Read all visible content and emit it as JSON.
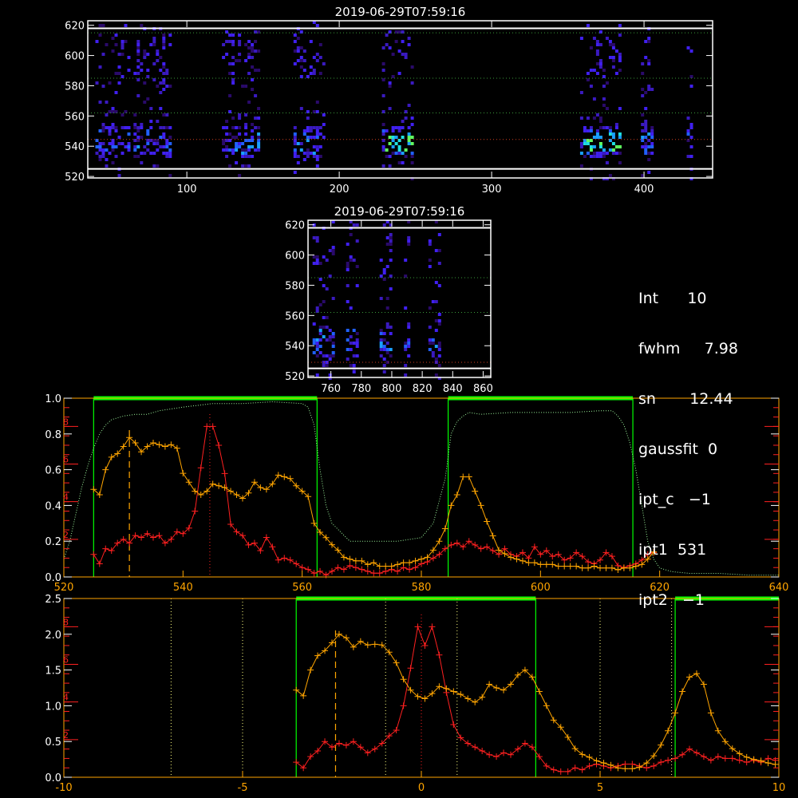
{
  "colors": {
    "white": "#ffffff",
    "orange": "#ffa500",
    "red": "#ff2020",
    "green": "#00ff00",
    "dotted_green": "#9cf59c",
    "grid_green": "#3a9a3a",
    "grid_red": "#d04020",
    "yellow_dotted": "#ffff80"
  },
  "info": [
    {
      "key": "Int",
      "value": "10"
    },
    {
      "key": "fwhm",
      "value": "7.98"
    },
    {
      "key": "sn",
      "value": "12.44"
    },
    {
      "key": "gaussfit",
      "value": "0"
    },
    {
      "key": "ipt_c",
      "value": "−1"
    },
    {
      "key": "ipt1",
      "value": "531"
    },
    {
      "key": "ipt2",
      "value": "−1"
    }
  ],
  "info_lines": [
    "Int      10",
    "fwhm     7.98",
    "sn       12.44",
    "gaussfit  0",
    "ipt_c   −1",
    "ipt1  531",
    "ipt2   −1"
  ],
  "chart_data": [
    {
      "type": "heatmap",
      "id": "top",
      "title": "2019-06-29T07:59:16",
      "xlim": [
        35,
        445
      ],
      "ylim": [
        519,
        623
      ],
      "xticks": [
        100,
        200,
        300,
        400
      ],
      "yticks": [
        520,
        540,
        560,
        580,
        600,
        620
      ],
      "hlines": [
        {
          "y": 525,
          "style": "solid"
        },
        {
          "y": 544.5,
          "style": "red-dotted"
        },
        {
          "y": 562,
          "style": "green-dotted"
        },
        {
          "y": 585,
          "style": "green-dotted"
        },
        {
          "y": 615,
          "style": "green-dotted"
        },
        {
          "y": 618,
          "style": "solid"
        }
      ],
      "bands": [
        [
          40,
          63
        ],
        [
          65,
          90
        ],
        [
          123,
          148
        ],
        [
          170,
          190
        ],
        [
          228,
          248
        ],
        [
          358,
          385
        ],
        [
          398,
          405
        ],
        [
          428,
          431
        ]
      ],
      "hot_bands": [
        [
          228,
          248
        ],
        [
          360,
          385
        ]
      ],
      "hot_rows": [
        538,
        550
      ]
    },
    {
      "type": "heatmap",
      "id": "mid",
      "title": "2019-06-29T07:59:16",
      "xlim": [
        745,
        865
      ],
      "ylim": [
        519,
        623
      ],
      "xticks": [
        760,
        780,
        800,
        820,
        840,
        860
      ],
      "yticks": [
        520,
        540,
        560,
        580,
        600,
        620
      ],
      "hlines": [
        {
          "y": 525,
          "style": "solid"
        },
        {
          "y": 529,
          "style": "red-dotted"
        },
        {
          "y": 562,
          "style": "green-dotted"
        },
        {
          "y": 585,
          "style": "green-dotted"
        },
        {
          "y": 618,
          "style": "solid"
        }
      ],
      "columns": [
        [
          748,
          762
        ],
        [
          770,
          778
        ],
        [
          792,
          800
        ],
        [
          808,
          812
        ],
        [
          824,
          832
        ]
      ]
    },
    {
      "type": "line",
      "id": "spectrum",
      "xlim": [
        520,
        640
      ],
      "xticks": [
        520,
        540,
        560,
        580,
        600,
        620,
        640
      ],
      "left_axis_ticks": [
        "0.0",
        "0.2",
        "0.4",
        "0.6",
        "0.8",
        "1.0"
      ],
      "right_axis_ticks": [
        "2",
        "4",
        "6",
        "8"
      ],
      "left_axis_max": 1.0,
      "right_axis_max": 9.5,
      "green_regions": [
        [
          525,
          562.5
        ],
        [
          584.5,
          615.5
        ]
      ],
      "orange_vline": 531,
      "red_vline": 544.5,
      "orange_x": [
        525,
        526,
        527,
        528,
        529,
        530,
        531,
        532,
        533,
        534,
        535,
        536,
        537,
        538,
        539,
        540,
        541,
        542,
        543,
        544,
        545,
        546,
        547,
        548,
        549,
        550,
        551,
        552,
        553,
        554,
        555,
        556,
        557,
        558,
        559,
        560,
        561,
        562,
        563,
        564,
        565,
        566,
        567,
        568,
        569,
        570,
        571,
        572,
        573,
        574,
        575,
        576,
        577,
        578,
        579,
        580,
        581,
        582,
        583,
        584,
        585,
        586,
        587,
        588,
        589,
        590,
        591,
        592,
        593,
        594,
        595,
        596,
        597,
        598,
        599,
        600,
        601,
        602,
        603,
        604,
        605,
        606,
        607,
        608,
        609,
        610,
        611,
        612,
        613,
        614,
        615,
        616,
        617,
        618,
        619
      ],
      "orange": [
        0.49,
        0.46,
        0.6,
        0.67,
        0.69,
        0.73,
        0.78,
        0.75,
        0.7,
        0.73,
        0.75,
        0.74,
        0.73,
        0.74,
        0.72,
        0.58,
        0.53,
        0.48,
        0.46,
        0.48,
        0.52,
        0.51,
        0.5,
        0.48,
        0.46,
        0.44,
        0.47,
        0.53,
        0.5,
        0.49,
        0.52,
        0.57,
        0.56,
        0.55,
        0.51,
        0.48,
        0.45,
        0.3,
        0.25,
        0.22,
        0.18,
        0.15,
        0.11,
        0.1,
        0.09,
        0.09,
        0.07,
        0.08,
        0.06,
        0.06,
        0.06,
        0.07,
        0.08,
        0.08,
        0.09,
        0.1,
        0.11,
        0.15,
        0.2,
        0.27,
        0.4,
        0.46,
        0.56,
        0.56,
        0.48,
        0.4,
        0.31,
        0.23,
        0.15,
        0.13,
        0.11,
        0.1,
        0.09,
        0.08,
        0.08,
        0.07,
        0.07,
        0.07,
        0.06,
        0.06,
        0.06,
        0.06,
        0.05,
        0.05,
        0.06,
        0.05,
        0.05,
        0.05,
        0.04,
        0.05,
        0.05,
        0.06,
        0.07,
        0.1,
        0.14
      ],
      "red_x": [
        525,
        526,
        527,
        528,
        529,
        530,
        531,
        532,
        533,
        534,
        535,
        536,
        537,
        538,
        539,
        540,
        541,
        542,
        543,
        544,
        545,
        546,
        547,
        548,
        549,
        550,
        551,
        552,
        553,
        554,
        555,
        556,
        557,
        558,
        559,
        560,
        561,
        562,
        563,
        564,
        565,
        566,
        567,
        568,
        569,
        570,
        571,
        572,
        573,
        574,
        575,
        576,
        577,
        578,
        579,
        580,
        581,
        582,
        583,
        584,
        585,
        586,
        587,
        588,
        589,
        590,
        591,
        592,
        593,
        594,
        595,
        596,
        597,
        598,
        599,
        600,
        601,
        602,
        603,
        604,
        605,
        606,
        607,
        608,
        609,
        610,
        611,
        612,
        613,
        614,
        615,
        616,
        617,
        618,
        619
      ],
      "red": [
        1.2,
        0.7,
        1.5,
        1.4,
        1.8,
        2.0,
        1.8,
        2.2,
        2.1,
        2.3,
        2.1,
        2.2,
        1.8,
        2.0,
        2.4,
        2.3,
        2.6,
        3.5,
        5.8,
        8.0,
        8.0,
        7.0,
        5.5,
        2.8,
        2.4,
        2.2,
        1.7,
        1.8,
        1.4,
        2.1,
        1.6,
        0.9,
        1.0,
        0.9,
        0.7,
        0.5,
        0.4,
        0.2,
        0.3,
        0.1,
        0.3,
        0.5,
        0.4,
        0.6,
        0.5,
        0.4,
        0.3,
        0.2,
        0.2,
        0.3,
        0.4,
        0.3,
        0.5,
        0.4,
        0.5,
        0.7,
        0.8,
        1.0,
        1.2,
        1.5,
        1.7,
        1.8,
        1.6,
        1.9,
        1.7,
        1.5,
        1.6,
        1.4,
        1.2,
        1.5,
        1.2,
        1.1,
        1.3,
        1.0,
        1.6,
        1.2,
        1.4,
        1.1,
        1.2,
        0.9,
        1.0,
        1.3,
        1.1,
        0.8,
        0.7,
        0.9,
        1.3,
        1.1,
        0.6,
        0.5,
        0.6,
        0.7,
        0.9,
        1.2,
        1.3
      ],
      "dotted_x": [
        520,
        521,
        522,
        523,
        524,
        525,
        526,
        527,
        528,
        530,
        532,
        534,
        536,
        540,
        545,
        550,
        555,
        560,
        561,
        562,
        563,
        564,
        565,
        568,
        572,
        576,
        580,
        582,
        584,
        585,
        586,
        587,
        588,
        590,
        595,
        600,
        605,
        610,
        612,
        613,
        614,
        615,
        616,
        617,
        618,
        619,
        620,
        622,
        625,
        630,
        635,
        640
      ],
      "dotted": [
        0.1,
        0.2,
        0.35,
        0.5,
        0.62,
        0.72,
        0.8,
        0.85,
        0.88,
        0.9,
        0.91,
        0.91,
        0.93,
        0.95,
        0.97,
        0.97,
        0.98,
        0.97,
        0.95,
        0.85,
        0.6,
        0.4,
        0.3,
        0.2,
        0.2,
        0.2,
        0.22,
        0.3,
        0.55,
        0.8,
        0.87,
        0.9,
        0.92,
        0.91,
        0.92,
        0.92,
        0.92,
        0.93,
        0.93,
        0.9,
        0.85,
        0.75,
        0.6,
        0.4,
        0.2,
        0.1,
        0.05,
        0.03,
        0.02,
        0.02,
        0.01,
        0.01
      ]
    },
    {
      "type": "line",
      "id": "velocity",
      "xlim": [
        -10,
        10
      ],
      "xticks": [
        -10,
        -5,
        0,
        5,
        10
      ],
      "left_axis_ticks": [
        "0.0",
        "0.5",
        "1.0",
        "1.5",
        "2.0",
        "2.5"
      ],
      "right_axis_ticks": [
        "2",
        "4",
        "6",
        "8"
      ],
      "left_axis_max": 2.5,
      "right_axis_max": 9.5,
      "green_regions": [
        [
          -3.5,
          3.2
        ],
        [
          7.1,
          10
        ]
      ],
      "orange_vline": -2.4,
      "red_vline": 0,
      "white_dotted_vlines": [
        -7,
        -5,
        -1,
        1,
        5,
        7
      ],
      "orange_x": [
        -3.5,
        -3.3,
        -3.1,
        -2.9,
        -2.7,
        -2.5,
        -2.3,
        -2.1,
        -1.9,
        -1.7,
        -1.5,
        -1.3,
        -1.1,
        -0.9,
        -0.7,
        -0.5,
        -0.3,
        -0.1,
        0.1,
        0.3,
        0.5,
        0.7,
        0.9,
        1.1,
        1.3,
        1.5,
        1.7,
        1.9,
        2.1,
        2.3,
        2.5,
        2.7,
        2.9,
        3.1,
        3.3,
        3.5,
        3.7,
        3.9,
        4.1,
        4.3,
        4.5,
        4.7,
        4.9,
        5.1,
        5.3,
        5.5,
        5.7,
        5.9,
        6.1,
        6.3,
        6.5,
        6.7,
        6.9,
        7.1,
        7.3,
        7.5,
        7.7,
        7.9,
        8.1,
        8.3,
        8.5,
        8.7,
        8.9,
        9.1,
        9.3,
        9.5,
        9.7,
        9.9
      ],
      "orange": [
        1.22,
        1.14,
        1.5,
        1.7,
        1.77,
        1.88,
        2.0,
        1.95,
        1.82,
        1.9,
        1.85,
        1.86,
        1.85,
        1.75,
        1.6,
        1.37,
        1.22,
        1.13,
        1.1,
        1.17,
        1.27,
        1.24,
        1.2,
        1.16,
        1.1,
        1.05,
        1.12,
        1.3,
        1.25,
        1.22,
        1.3,
        1.43,
        1.5,
        1.4,
        1.2,
        1.0,
        0.8,
        0.7,
        0.56,
        0.4,
        0.32,
        0.28,
        0.23,
        0.2,
        0.17,
        0.13,
        0.12,
        0.12,
        0.14,
        0.2,
        0.3,
        0.45,
        0.65,
        0.9,
        1.2,
        1.4,
        1.45,
        1.3,
        0.9,
        0.65,
        0.5,
        0.4,
        0.33,
        0.28,
        0.25,
        0.23,
        0.2,
        0.18
      ],
      "red_x": [
        -3.5,
        -3.3,
        -3.1,
        -2.9,
        -2.7,
        -2.5,
        -2.3,
        -2.1,
        -1.9,
        -1.7,
        -1.5,
        -1.3,
        -1.1,
        -0.9,
        -0.7,
        -0.5,
        -0.3,
        -0.1,
        0.1,
        0.3,
        0.5,
        0.7,
        0.9,
        1.1,
        1.3,
        1.5,
        1.7,
        1.9,
        2.1,
        2.3,
        2.5,
        2.7,
        2.9,
        3.1,
        3.3,
        3.5,
        3.7,
        3.9,
        4.1,
        4.3,
        4.5,
        4.7,
        4.9,
        5.1,
        5.3,
        5.5,
        5.7,
        5.9,
        6.1,
        6.3,
        6.5,
        6.7,
        6.9,
        7.1,
        7.3,
        7.5,
        7.7,
        7.9,
        8.1,
        8.3,
        8.5,
        8.7,
        8.9,
        9.1,
        9.3,
        9.5,
        9.7,
        9.9
      ],
      "red": [
        0.8,
        0.5,
        1.1,
        1.4,
        1.9,
        1.6,
        1.8,
        1.7,
        1.9,
        1.6,
        1.3,
        1.5,
        1.8,
        2.2,
        2.5,
        3.8,
        5.8,
        8.0,
        7.0,
        8.0,
        6.5,
        4.5,
        2.8,
        2.1,
        1.8,
        1.6,
        1.4,
        1.2,
        1.1,
        1.3,
        1.2,
        1.5,
        1.8,
        1.6,
        1.1,
        0.6,
        0.4,
        0.3,
        0.3,
        0.5,
        0.4,
        0.6,
        0.7,
        0.6,
        0.5,
        0.6,
        0.7,
        0.7,
        0.6,
        0.5,
        0.6,
        0.8,
        0.9,
        1.0,
        1.2,
        1.5,
        1.3,
        1.1,
        0.9,
        1.1,
        1.0,
        1.0,
        0.9,
        0.8,
        0.9,
        0.8,
        1.0,
        0.9
      ]
    }
  ]
}
